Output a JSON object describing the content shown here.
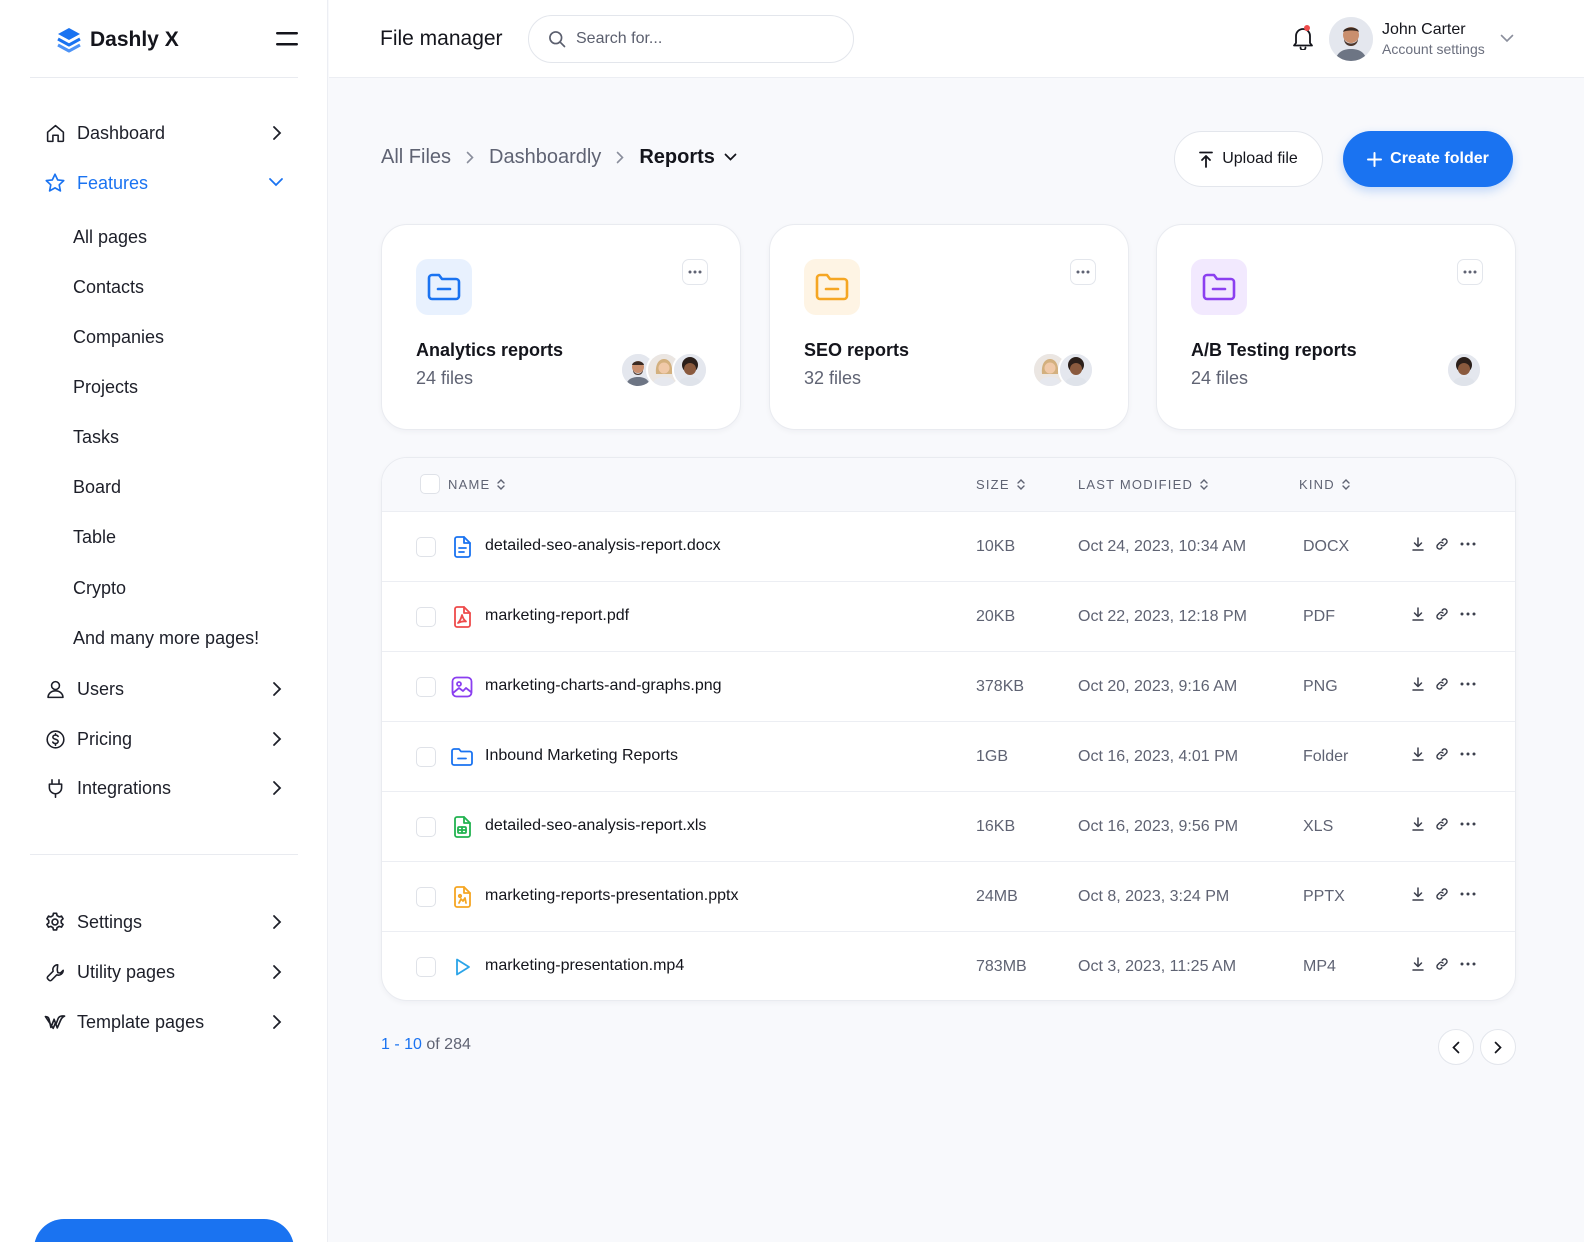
{
  "brand": {
    "name": "Dashly X",
    "accent": "#1a73f1"
  },
  "sidebar": {
    "items": [
      {
        "label": "Dashboard",
        "icon": "home-icon"
      },
      {
        "label": "Features",
        "icon": "star-icon",
        "active": true
      },
      {
        "label": "Users",
        "icon": "user-icon"
      },
      {
        "label": "Pricing",
        "icon": "dollar-icon"
      },
      {
        "label": "Integrations",
        "icon": "plug-icon"
      }
    ],
    "sub_items": [
      "All pages",
      "Contacts",
      "Companies",
      "Projects",
      "Tasks",
      "Board",
      "Table",
      "Crypto",
      "And many more pages!"
    ],
    "bottom_items": [
      {
        "label": "Settings",
        "icon": "gear-icon"
      },
      {
        "label": "Utility pages",
        "icon": "wrench-icon"
      },
      {
        "label": "Template pages",
        "icon": "webflow-icon"
      }
    ]
  },
  "header": {
    "title": "File manager",
    "search_placeholder": "Search for...",
    "user_name": "John Carter",
    "user_sub": "Account settings"
  },
  "breadcrumb": {
    "items": [
      "All Files",
      "Dashboardly"
    ],
    "current": "Reports"
  },
  "actions": {
    "upload": "Upload file",
    "create": "Create folder"
  },
  "folders": [
    {
      "title": "Analytics reports",
      "files": "24 files",
      "color": "#1a73f1",
      "bg": "#e8f1fe",
      "avatars": 3
    },
    {
      "title": "SEO reports",
      "files": "32 files",
      "color": "#f5a623",
      "bg": "#fef4e4",
      "avatars": 2
    },
    {
      "title": "A/B Testing reports",
      "files": "24 files",
      "color": "#8b3ff0",
      "bg": "#f2e9fe",
      "avatars": 1
    }
  ],
  "table": {
    "columns": {
      "name": "NAME",
      "size": "SIZE",
      "modified": "LAST MODIFIED",
      "kind": "KIND"
    },
    "rows": [
      {
        "name": "detailed-seo-analysis-report.docx",
        "size": "10KB",
        "modified": "Oct 24, 2023, 10:34 AM",
        "kind": "DOCX",
        "icon": "doc-icon",
        "color": "#1a73f1"
      },
      {
        "name": "marketing-report.pdf",
        "size": "20KB",
        "modified": "Oct 22, 2023, 12:18 PM",
        "kind": "PDF",
        "icon": "pdf-icon",
        "color": "#ee4b4b"
      },
      {
        "name": "marketing-charts-and-graphs.png",
        "size": "378KB",
        "modified": "Oct 20, 2023, 9:16 AM",
        "kind": "PNG",
        "icon": "image-icon",
        "color": "#8b3ff0"
      },
      {
        "name": "Inbound Marketing Reports",
        "size": "1GB",
        "modified": "Oct 16, 2023, 4:01 PM",
        "kind": "Folder",
        "icon": "folder-icon",
        "color": "#1a73f1"
      },
      {
        "name": "detailed-seo-analysis-report.xls",
        "size": "16KB",
        "modified": "Oct 16, 2023, 9:56 PM",
        "kind": "XLS",
        "icon": "spreadsheet-icon",
        "color": "#22b350"
      },
      {
        "name": "marketing-reports-presentation.pptx",
        "size": "24MB",
        "modified": "Oct 8, 2023, 3:24 PM",
        "kind": "PPTX",
        "icon": "presentation-icon",
        "color": "#f5a623"
      },
      {
        "name": "marketing-presentation.mp4",
        "size": "783MB",
        "modified": "Oct 3, 2023, 11:25 AM",
        "kind": "MP4",
        "icon": "play-icon",
        "color": "#2ba4e8"
      }
    ]
  },
  "pagination": {
    "range": "1 - 10",
    "of": "of 284"
  }
}
